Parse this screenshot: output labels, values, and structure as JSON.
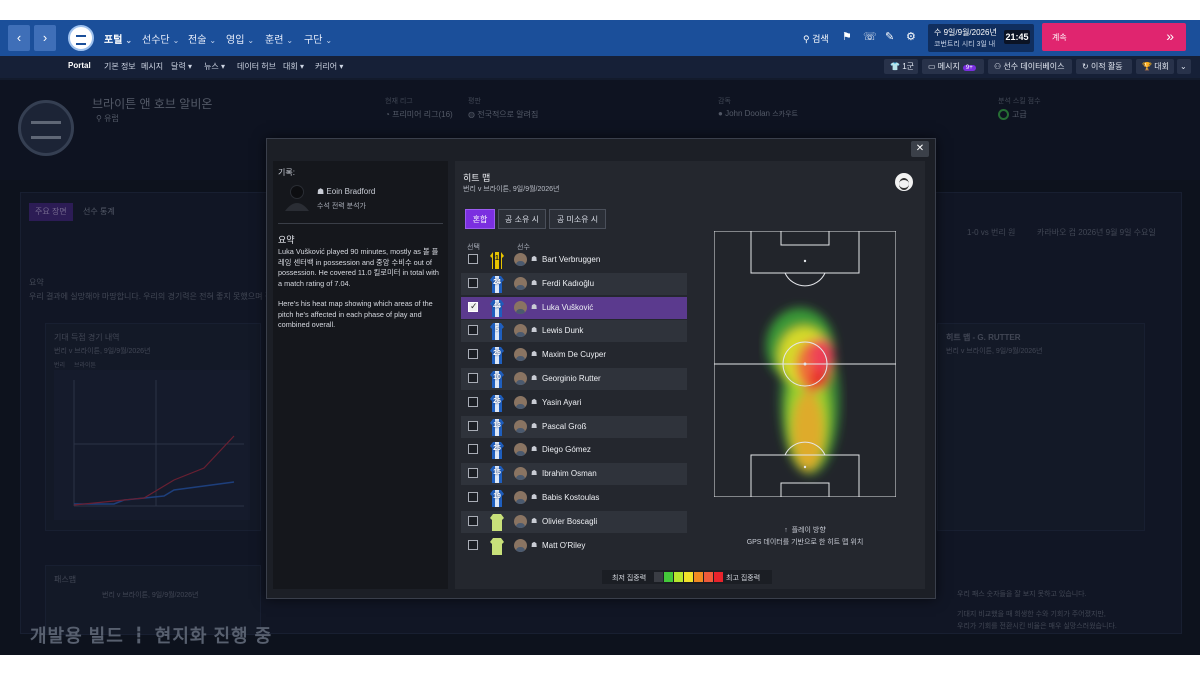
{
  "topnav": {
    "back_icon": "chevron-left-icon",
    "forward_icon": "chevron-right-icon",
    "menus": [
      "포털",
      "선수단",
      "전술",
      "영입",
      "훈련",
      "구단"
    ],
    "search_label": "검색",
    "date_line1": "수 9일/9월/2026년",
    "date_line2": "코번트리 시티 3일 내",
    "time": "21:45",
    "continue_label": "계속"
  },
  "subnav": {
    "portal": "Portal",
    "items": [
      "기본 정보",
      "메시지",
      "달력",
      "뉴스",
      "데이터 허브",
      "대회",
      "커리어"
    ],
    "right_buttons": {
      "first_team": "1군",
      "messages": "메시지",
      "messages_badge": "9+",
      "player_db": "선수 데이터베이스",
      "transfer": "이적 활동",
      "competitions": "대회"
    }
  },
  "club": {
    "name": "브라이튼 앤 호브 알비온",
    "region": "유럽",
    "league_label": "현재 리그",
    "league_value": "프리미어 리그(16)",
    "reputation_label": "평판",
    "reputation_value": "전국적으로 알려짐",
    "manager_label": "감독",
    "manager_value": "John Doolan",
    "manager_role": "스카우트",
    "form_label": "분석 스킬 점수",
    "form_value": "고급"
  },
  "background": {
    "tabs": [
      "주요 장면",
      "선수 통계"
    ],
    "summary_label": "요약",
    "summary_text": "우리 결과에 실망해야 마땅합니다. 우리의 경기력은 전혀 좋지 못했으며 결과",
    "xg_title": "기대 득점 경기 내역",
    "xg_subtitle": "번리 v 브라이튼, 9일/9월/2026년",
    "xg_legend": [
      "번리",
      "브라이튼"
    ],
    "pass_title": "패스맵",
    "pass_subtitle": "번리 v 브라이튼, 9일/9월/2026년",
    "score": "1-0 vs 번리 원",
    "cup": "카라바오 컵 2026년 9월 9일 수요일",
    "heat_title": "히트 맵 - G. RUTTER",
    "heat_subtitle": "번리 v 브라이튼, 9일/9월/2026년",
    "right_text1": "우리 패스 숫자들을 잘 보지 못하고 있습니다.",
    "right_text2": "기대지 비교했을 때 희생한 수와 기회가 주어졌지만,",
    "right_text3": "우리가 기회를 전환시킨 비율은 매우 실망스러웠습니다.",
    "dev_watermark": "개발용 빌드 ┇ 현지화 진행 중"
  },
  "modal": {
    "close_icon": "close-icon",
    "record_label": "기록:",
    "analyst_name": "Eoin Bradford",
    "analyst_role": "수석 전력 분석가",
    "summary_heading": "요약",
    "summary_p1": "Luka Vušković played 90 minutes, mostly as 볼 플레잉 센터백 in possession and 중앙 수비수 out of possession. He covered 11.0 킬로미터 in total with a match rating of 7.04.",
    "summary_p2": "Here's his heat map showing which areas of the pitch he's affected in each phase of play and combined overall.",
    "heatmap_title": "히트 맵",
    "heatmap_subtitle": "번리 v 브라이튼, 9일/9월/2026년",
    "toggles": [
      "혼합",
      "공 소유 시",
      "공 미소유 시"
    ],
    "col_select": "선택",
    "col_player": "선수",
    "players": [
      {
        "num": "1",
        "name": "Bart Verbruggen",
        "checked": false,
        "kit": "gk"
      },
      {
        "num": "24",
        "name": "Ferdi Kadıoğlu",
        "checked": false,
        "kit": "home"
      },
      {
        "num": "44",
        "name": "Luka Vušković",
        "checked": true,
        "kit": "home"
      },
      {
        "num": "5",
        "name": "Lewis Dunk",
        "checked": false,
        "kit": "home"
      },
      {
        "num": "29",
        "name": "Maxim De Cuyper",
        "checked": false,
        "kit": "home"
      },
      {
        "num": "10",
        "name": "Georginio Rutter",
        "checked": false,
        "kit": "home"
      },
      {
        "num": "26",
        "name": "Yasin Ayari",
        "checked": false,
        "kit": "home"
      },
      {
        "num": "13",
        "name": "Pascal Groß",
        "checked": false,
        "kit": "home"
      },
      {
        "num": "25",
        "name": "Diego Gómez",
        "checked": false,
        "kit": "home"
      },
      {
        "num": "15",
        "name": "Ibrahim Osman",
        "checked": false,
        "kit": "home"
      },
      {
        "num": "19",
        "name": "Babis Kostoulas",
        "checked": false,
        "kit": "home"
      },
      {
        "num": "",
        "name": "Olivier Boscagli",
        "checked": false,
        "kit": "sub"
      },
      {
        "num": "",
        "name": "Matt O'Riley",
        "checked": false,
        "kit": "sub"
      }
    ],
    "direction_label": "플레이 방향",
    "gps_label": "GPS 데이터를 기반으로 한 히트 맵 위치",
    "legend_low": "최저 집중력",
    "legend_high": "최고 집중력",
    "legend_colors": [
      "#3a3d44",
      "#44c93a",
      "#b7e82e",
      "#f0e22a",
      "#f08a22",
      "#ef5a3a",
      "#e8232b"
    ]
  }
}
